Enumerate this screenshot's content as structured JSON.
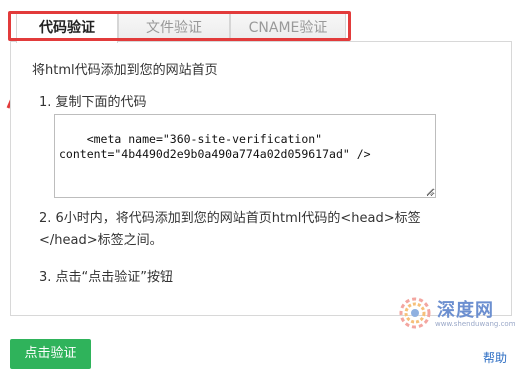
{
  "tabs": [
    {
      "label": "代码验证",
      "active": true
    },
    {
      "label": "文件验证",
      "active": false
    },
    {
      "label": "CNAME验证",
      "active": false
    }
  ],
  "intro": "将html代码添加到您的网站首页",
  "steps": {
    "step1": "1. 复制下面的代码",
    "step2": "2. 6小时内，将代码添加到您的网站首页html代码的<head>标签</head>标签之间。",
    "step3": "3. 点击“点击验证”按钮"
  },
  "code": "<meta name=\"360-site-verification\"\ncontent=\"4b4490d2e9b0a490a774a02d059617ad\" />",
  "buttons": {
    "verify": "点击验证",
    "help": "帮助"
  },
  "watermark": {
    "name": "深度网",
    "url": "www.shenduwang.com"
  },
  "colors": {
    "highlight": "#e23b3b",
    "accent_green": "#2fb35b",
    "link_blue": "#2f6fc4"
  }
}
